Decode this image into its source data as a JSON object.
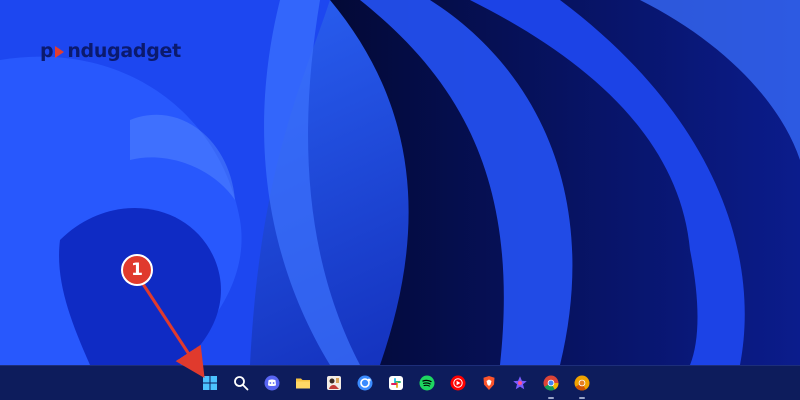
{
  "watermark": {
    "prefix": "p",
    "suffix": "ndugadget",
    "brand_color": "#0b1a6e",
    "accent_color": "#e33d2f"
  },
  "annotation": {
    "step_number": "1",
    "color": "#e03a2d"
  },
  "taskbar": {
    "background": "#0d1c5c",
    "apps": [
      {
        "id": "start",
        "icon": "windows-start-icon",
        "running": false
      },
      {
        "id": "search",
        "icon": "search-icon",
        "running": false
      },
      {
        "id": "discord",
        "icon": "discord-icon",
        "running": false
      },
      {
        "id": "file-explorer",
        "icon": "folder-icon",
        "running": false
      },
      {
        "id": "app-thumbnail",
        "icon": "app-thumbnail-icon",
        "running": false
      },
      {
        "id": "refresh-app",
        "icon": "sync-icon",
        "running": false
      },
      {
        "id": "slack",
        "icon": "slack-icon",
        "running": false
      },
      {
        "id": "spotify",
        "icon": "spotify-icon",
        "running": false
      },
      {
        "id": "youtube-music",
        "icon": "youtube-music-icon",
        "running": false
      },
      {
        "id": "brave",
        "icon": "brave-icon",
        "running": false
      },
      {
        "id": "star-app",
        "icon": "star-app-icon",
        "running": false
      },
      {
        "id": "chrome",
        "icon": "chrome-icon",
        "running": true
      },
      {
        "id": "chrome-canary",
        "icon": "chrome-canary-icon",
        "running": true
      }
    ]
  }
}
